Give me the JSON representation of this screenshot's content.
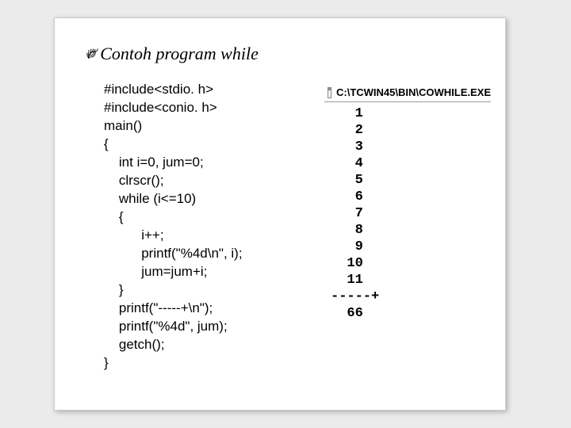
{
  "heading": {
    "symbol": "༗",
    "text": "Contoh program while"
  },
  "code": {
    "lines": [
      "#include<stdio. h>",
      "#include<conio. h>",
      "main()",
      "{",
      "    int i=0, jum=0;",
      "    clrscr();",
      "    while (i<=10)",
      "    {",
      "          i++;",
      "          printf(\"%4d\\n\", i);",
      "          jum=jum+i;",
      "    }",
      "    printf(\"-----+\\n\");",
      "    printf(\"%4d\", jum);",
      "    getch();",
      "}"
    ]
  },
  "output": {
    "title": "C:\\TCWIN45\\BIN\\COWHILE.EXE",
    "lines": [
      "   1",
      "   2",
      "   3",
      "   4",
      "   5",
      "   6",
      "   7",
      "   8",
      "   9",
      "  10",
      "  11",
      "-----+",
      "  66"
    ]
  }
}
